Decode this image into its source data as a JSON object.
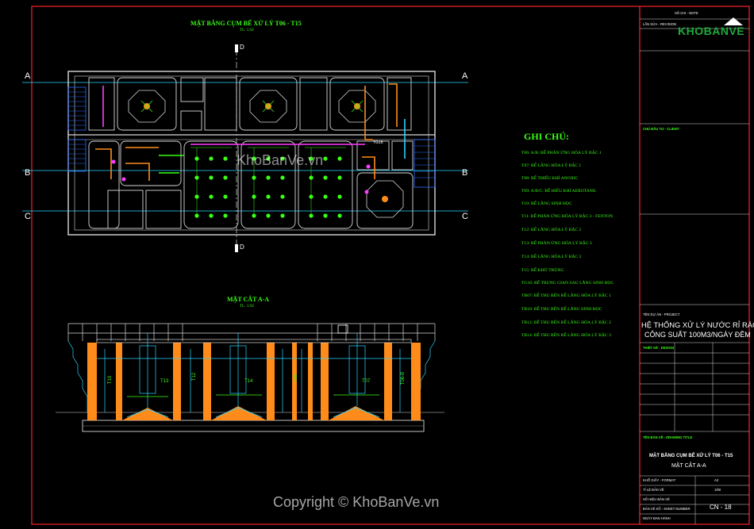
{
  "plan": {
    "title": "MẶT BẰNG CỤM BỂ XỬ LÝ T06 - T15",
    "scale": "TL: 1/50",
    "axes": [
      "A",
      "B",
      "C"
    ],
    "section_mark": "D",
    "tank_labels": [
      "TG16"
    ]
  },
  "section": {
    "title": "MẶT CẮT A-A",
    "scale": "TL: 1/50",
    "tank_labels": [
      "T10",
      "T13",
      "T12",
      "T14",
      "T15",
      "T07",
      "T06-B"
    ]
  },
  "notes": {
    "heading": "GHI CHÚ:",
    "items": [
      "T06: A/B: BỂ PHẢN ỨNG HÓA LÝ BẬC 1",
      "T07: BỂ LẮNG HÓA LÝ BẬC 1",
      "T08: BỂ THIẾU KHÍ ANOXIC",
      "T09: A/B/C: BỂ HIẾU KHÍ AEROTANK",
      "T10: BỂ LẮNG SINH HỌC",
      "T11: BỂ PHẢN ỨNG HÓA LÝ BẬC 2 - FENTON",
      "T12: BỂ LẮNG HÓA LÝ BẬC 2",
      "T13: BỂ PHẢN ỨNG HÓA LÝ BẬC 3",
      "T14: BỂ LẮNG HÓA LÝ BẬC 3",
      "T15: BỂ KHỬ TRÙNG",
      "TG16: BỂ TRUNG GIAN SAU LẮNG SINH HỌC",
      "TB07: BỂ THU BÊN BỂ LẮNG HÓA LÝ BẬC 1",
      "TB10: BỂ THU BÊN BỂ LẮNG SINH HỌC",
      "TB12: BỂ THU BÊN BỂ LẮNG HÓA LÝ BẬC 2",
      "TB14: BỂ THU BÊN BỂ LẮNG HÓA LÝ BẬC 3"
    ]
  },
  "title_block": {
    "top_rows": [
      "SỐ CHI - NOTE",
      "LẦN SỬA - REVISION"
    ],
    "owner_label": "CHỦ ĐẦU TƯ - CLIENT:",
    "project_label": "TÊN DỰ ÁN - PROJECT",
    "project_name_1": "HỆ THỐNG XỬ LÝ NƯỚC RỈ RÁC",
    "project_name_2": "CÔNG SUẤT 100M3/NGÀY ĐÊM",
    "design_label": "THIẾT KẾ - DESIGN",
    "drawing_label": "TÊN BẢN VẼ - DRAWING TITLE",
    "drawing_name_1": "MẶT BẰNG CỤM BỂ XỬ LÝ T06 - T15",
    "drawing_name_2": "MẶT CẮT A-A",
    "rows": [
      {
        "label": "KHỔ GIẤY - FORMAT",
        "value": "A3"
      },
      {
        "label": "TỈ LỆ BẢN VẼ",
        "value": "1/50"
      },
      {
        "label": "SỐ HIỆU BẢN VẼ",
        "value": ""
      },
      {
        "label": "BẢN VẼ SỐ - SHEET NUMBER",
        "value": "CN - 18"
      },
      {
        "label": "NGÀY BAN HÀNH",
        "value": ""
      }
    ],
    "sheet_number": "CN - 18"
  },
  "watermark": {
    "logo_top": "KHOBANVE",
    "center": "KhoBanVe.vn",
    "copyright": "Copyright © KhoBanVe.vn"
  },
  "colors": {
    "background": "#000000",
    "frame": "#e8202a",
    "lines": "#d8d8d8",
    "green_text": "#39ff14",
    "cyan": "#2bd4ff",
    "orange": "#ff8c1a",
    "magenta": "#ff3cff"
  }
}
